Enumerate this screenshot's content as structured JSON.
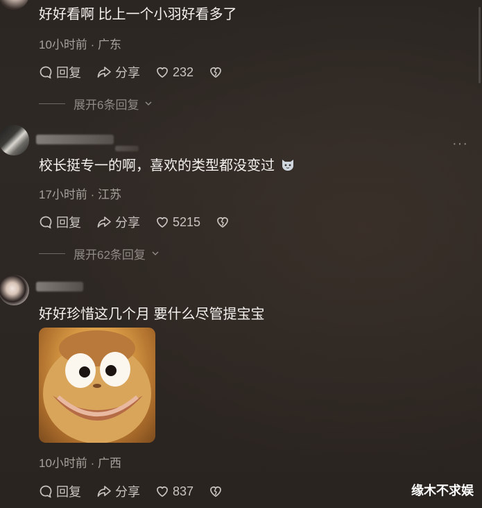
{
  "comments": [
    {
      "text": "好好看啊 比上一个小羽好看多了",
      "time_location": "10小时前 · 广东",
      "reply_label": "回复",
      "share_label": "分享",
      "likes": "232",
      "expand_label": "展开6条回复"
    },
    {
      "text": "校长挺专一的啊，喜欢的类型都没变过",
      "time_location": "17小时前 · 江苏",
      "reply_label": "回复",
      "share_label": "分享",
      "likes": "5215",
      "expand_label": "展开62条回复",
      "more_label": "···"
    },
    {
      "text": "好好珍惜这几个月 要什么尽管提宝宝",
      "time_location": "10小时前 · 广西",
      "reply_label": "回复",
      "share_label": "分享",
      "likes": "837"
    }
  ],
  "watermark": "缘木不求娱",
  "icons": {
    "reply": "reply-bubble-icon",
    "share": "share-arrow-icon",
    "like": "heart-icon",
    "dislike": "broken-heart-icon",
    "expand": "chevron-down-icon",
    "emoji": "cat-face-emoji"
  }
}
